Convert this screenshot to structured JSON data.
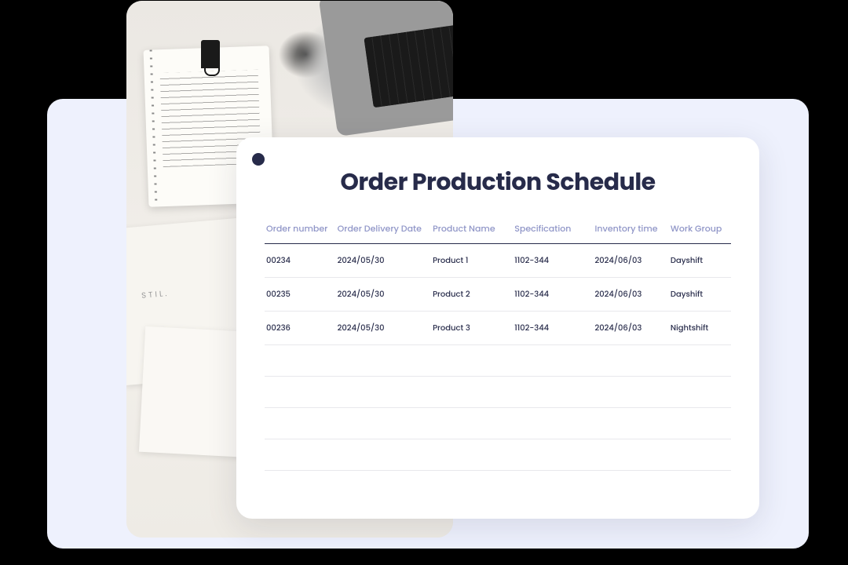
{
  "card": {
    "title": "Order Production Schedule",
    "columns": [
      "Order number",
      "Order Delivery Date",
      "Product Name",
      "Specification",
      "Inventory time",
      "Work Group"
    ],
    "rows": [
      {
        "order_number": "00234",
        "delivery_date": "2024/05/30",
        "product_name": "Product 1",
        "specification": "1102-344",
        "inventory_time": "2024/06/03",
        "work_group": "Dayshift"
      },
      {
        "order_number": "00235",
        "delivery_date": "2024/05/30",
        "product_name": "Product 2",
        "specification": "1102-344",
        "inventory_time": "2024/06/03",
        "work_group": "Dayshift"
      },
      {
        "order_number": "00236",
        "delivery_date": "2024/05/30",
        "product_name": "Product 3",
        "specification": "1102-344",
        "inventory_time": "2024/06/03",
        "work_group": "Nightshift"
      }
    ],
    "empty_row_count": 4
  },
  "colors": {
    "bg_dark": "#000000",
    "panel": "#eef1fd",
    "card": "#ffffff",
    "heading": "#272b4a",
    "col_header": "#8f95c7"
  }
}
